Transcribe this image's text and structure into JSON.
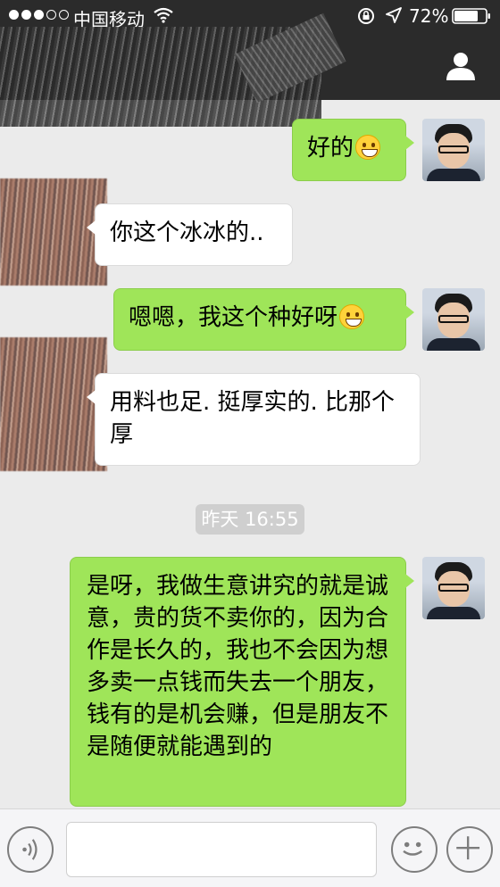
{
  "status_bar": {
    "carrier": "中国移动",
    "battery": "72%"
  },
  "messages": [
    {
      "side": "right",
      "text": "好的",
      "emoji": true
    },
    {
      "side": "left",
      "text": "你这个冰冰的.."
    },
    {
      "side": "right",
      "text": "嗯嗯，我这个种好呀",
      "emoji": true
    },
    {
      "side": "left",
      "text": "用料也足. 挺厚实的. 比那个厚"
    },
    {
      "side": "right",
      "text": "是呀，我做生意讲究的就是诚意，贵的货不卖你的，因为合作是长久的，我也不会因为想多卖一点钱而失去一个朋友，钱有的是机会赚，但是朋友不是随便就能遇到的"
    }
  ],
  "timestamp": "昨天 16:55",
  "colors": {
    "nav_bg": "#2b2b2b",
    "chat_bg": "#ebebeb",
    "bubble_right": "#9fe559",
    "bubble_left": "#ffffff"
  }
}
